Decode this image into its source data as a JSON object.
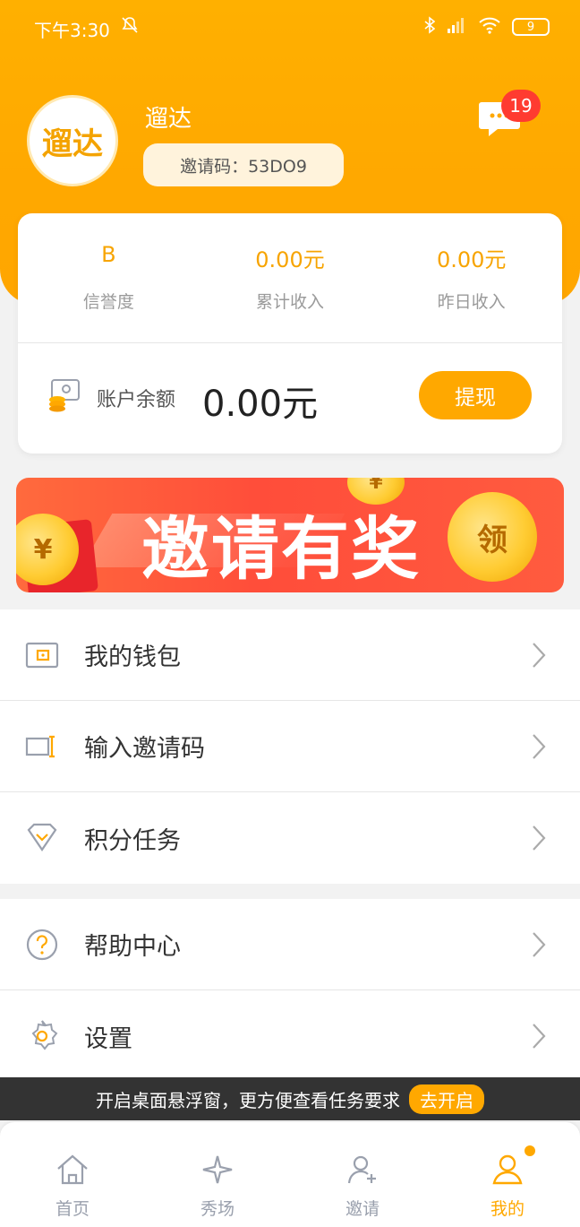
{
  "status_bar": {
    "time": "下午3:30",
    "battery": "9"
  },
  "profile": {
    "avatar_text": "遛达",
    "name": "遛达",
    "invite_code": "邀请码：53DO9",
    "message_count": "19"
  },
  "stats": [
    {
      "value": "B",
      "label": "信誉度"
    },
    {
      "value": "0.00元",
      "label": "累计收入"
    },
    {
      "value": "0.00元",
      "label": "昨日收入"
    }
  ],
  "balance": {
    "label": "账户余额",
    "value": "0.00元",
    "withdraw_label": "提现"
  },
  "banner": {
    "title": "邀请有奖",
    "coin_text": "领"
  },
  "menu_group_1": [
    {
      "label": "我的钱包",
      "icon": "wallet-icon"
    },
    {
      "label": "输入邀请码",
      "icon": "input-code-icon"
    },
    {
      "label": "积分任务",
      "icon": "diamond-icon"
    }
  ],
  "menu_group_2": [
    {
      "label": "帮助中心",
      "icon": "help-icon"
    },
    {
      "label": "设置",
      "icon": "gear-icon"
    }
  ],
  "float_bar": {
    "text": "开启桌面悬浮窗，更方便查看任务要求",
    "button": "去开启"
  },
  "tabs": [
    {
      "label": "首页",
      "icon": "home-icon"
    },
    {
      "label": "秀场",
      "icon": "star-icon"
    },
    {
      "label": "邀请",
      "icon": "invite-icon"
    },
    {
      "label": "我的",
      "icon": "profile-icon",
      "active": true
    }
  ],
  "colors": {
    "accent": "#ffa800",
    "badge": "#ff3b30",
    "text_muted": "#9a9a9a"
  }
}
